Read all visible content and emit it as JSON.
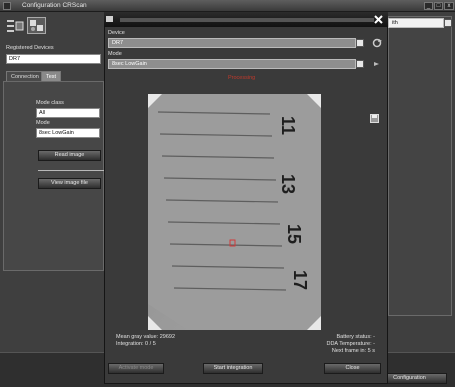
{
  "window": {
    "title": "Configuration CRScan"
  },
  "sidebar": {
    "registered_devices_label": "Registered Devices",
    "device_value": "DR7",
    "tabs": [
      {
        "label": "Connection"
      },
      {
        "label": "Test"
      }
    ],
    "mode_class_label": "Mode class",
    "mode_class_value": "All",
    "mode_label": "Mode",
    "mode_value": "8sec LowGain",
    "read_image_button": "Read image",
    "view_image_file_button": "View image file"
  },
  "right_panel": {
    "partial_combo_text": "ith"
  },
  "bottom": {
    "configuration_button": "Configuration"
  },
  "dialog": {
    "device_label": "Device",
    "device_value": "DR7",
    "mode_label": "Mode",
    "mode_value": "8sec LowGain",
    "status_text": "Processing",
    "ruler_numbers": [
      "11",
      "13",
      "15",
      "17"
    ],
    "left_stats": [
      "Mean gray value: 29692",
      "Integration: 0 / 5"
    ],
    "right_stats": [
      "Battery status: -",
      "DDA Temperature: -",
      "Next frame in: 5 s"
    ],
    "buttons": {
      "activate_mode": "Activate mode",
      "start_integration": "Start integration",
      "close": "Close"
    }
  },
  "colors": {
    "status_red": "#c0392b",
    "marker_red": "#d23a3a"
  }
}
